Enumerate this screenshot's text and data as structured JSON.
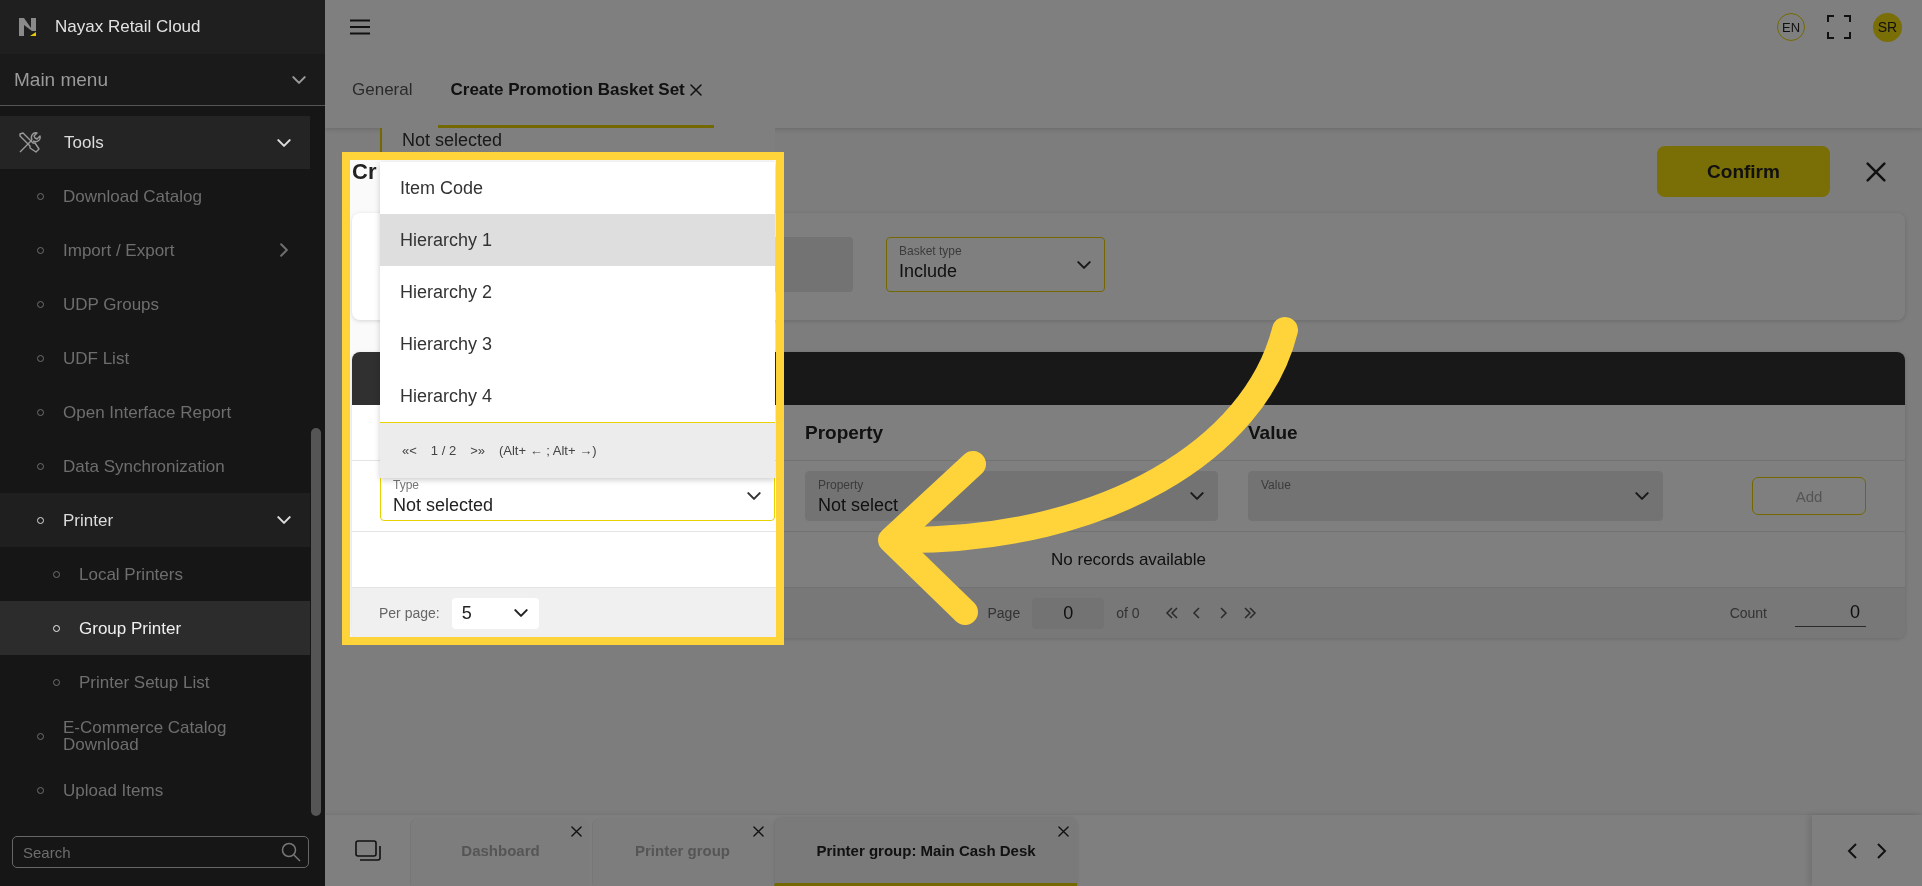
{
  "app": {
    "title": "Nayax Retail Cloud"
  },
  "sidebar": {
    "menu_title": "Main menu",
    "items": [
      {
        "label": "Tools",
        "expanded": true,
        "selected": false,
        "children": [
          {
            "label": "Download Catalog",
            "selected": false
          },
          {
            "label": "Import / Export",
            "expanded": false,
            "selected": false
          },
          {
            "label": "UDP Groups",
            "selected": false
          },
          {
            "label": "UDF List",
            "selected": false
          },
          {
            "label": "Open Interface Report",
            "selected": false
          },
          {
            "label": "Data Synchronization",
            "selected": false
          },
          {
            "label": "Printer",
            "expanded": true,
            "selected": false,
            "children": [
              {
                "label": "Local Printers",
                "selected": false
              },
              {
                "label": "Group Printer",
                "selected": true
              },
              {
                "label": "Printer Setup List",
                "selected": false
              }
            ]
          },
          {
            "label": "E-Commerce Catalog Download",
            "selected": false
          },
          {
            "label": "Upload Items",
            "selected": false
          }
        ]
      }
    ],
    "search_placeholder": "Search"
  },
  "header": {
    "language": "EN",
    "user_initials": "SR"
  },
  "page_tabs": [
    {
      "label": "General",
      "selected": false,
      "closable": false
    },
    {
      "label": "Create Promotion Basket Set",
      "selected": true,
      "closable": true
    }
  ],
  "form": {
    "title": "Cr",
    "confirm": "Confirm",
    "field_above": {
      "value": "Not selected"
    },
    "basket_type": {
      "label": "Basket type",
      "value": "Include"
    }
  },
  "dropdown": {
    "options": [
      {
        "label": "Item Code",
        "selected": false
      },
      {
        "label": "Hierarchy 1",
        "selected": true
      },
      {
        "label": "Hierarchy 2",
        "selected": false
      },
      {
        "label": "Hierarchy 3",
        "selected": false
      },
      {
        "label": "Hierarchy 4",
        "selected": false
      }
    ],
    "pager": {
      "first_prev": "«<",
      "page": "1 / 2",
      "next_last": ">»",
      "hint": "(Alt+ ← ; Alt+ →)"
    }
  },
  "table": {
    "columns": [
      "Property",
      "Value"
    ],
    "inputs": [
      {
        "kind": "select",
        "label": "Type",
        "value": "Not selected",
        "disabled": false
      },
      {
        "kind": "select",
        "label": "Property",
        "value": "Not select",
        "disabled": true
      },
      {
        "kind": "select",
        "label": "Value",
        "disabled": true
      },
      {
        "kind": "button",
        "label": "Add",
        "disabled": true
      }
    ],
    "empty_text": "No records available",
    "footer": {
      "per_page_label": "Per page:",
      "per_page": "5",
      "page_label": "Page",
      "page": "0",
      "of": "of 0",
      "count_label": "Count",
      "count": "0"
    }
  },
  "workspace_tabs": [
    {
      "label": "Dashboard",
      "selected": false
    },
    {
      "label": "Printer group",
      "selected": false
    },
    {
      "label": "Printer group: Main Cash Desk",
      "selected": true
    }
  ]
}
